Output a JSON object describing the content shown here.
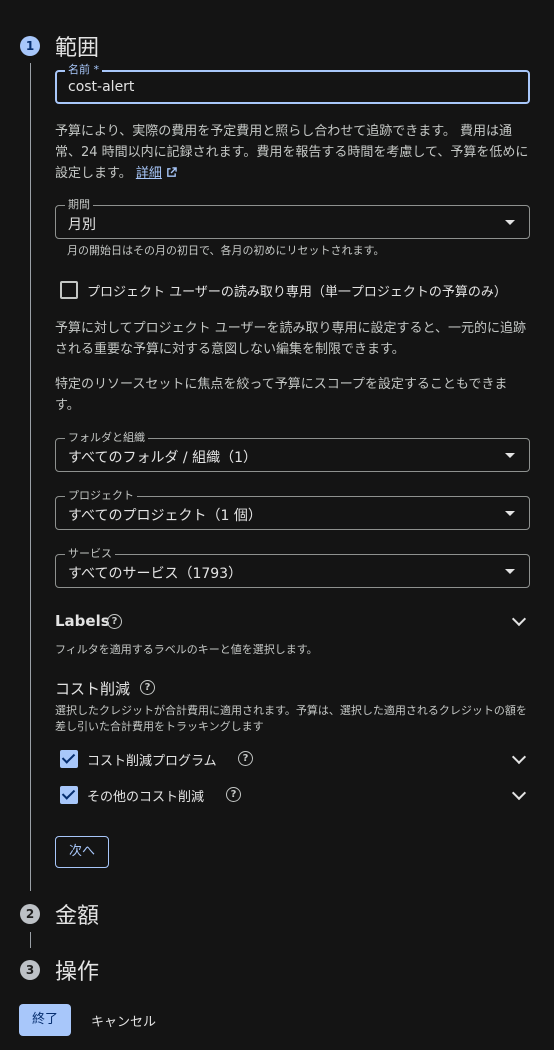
{
  "steps": [
    {
      "number": "1",
      "title": "範囲"
    },
    {
      "number": "2",
      "title": "金額"
    },
    {
      "number": "3",
      "title": "操作"
    }
  ],
  "name_field": {
    "label": "名前 *",
    "value": "cost-alert"
  },
  "intro_text": "予算により、実際の費用を予定費用と照らし合わせて追跡できます。 費用は通常、24 時間以内に記録されます。費用を報告する時間を考慮して、予算を低めに設定します。",
  "details_link": "詳細",
  "period": {
    "label": "期間",
    "value": "月別",
    "hint": "月の開始日はその月の初日で、各月の初めにリセットされます。"
  },
  "readonly_checkbox": {
    "label": "プロジェクト ユーザーの読み取り専用（単一プロジェクトの予算のみ）",
    "checked": false
  },
  "readonly_text": "予算に対してプロジェクト ユーザーを読み取り専用に設定すると、一元的に追跡される重要な予算に対する意図しない編集を制限できます。",
  "scope_text": "特定のリソースセットに焦点を絞って予算にスコープを設定することもできます。",
  "folders": {
    "label": "フォルダと組織",
    "value": "すべてのフォルダ / 組織（1）"
  },
  "projects": {
    "label": "プロジェクト",
    "value": "すべてのプロジェクト（1 個）"
  },
  "services": {
    "label": "サービス",
    "value": "すべてのサービス（1793）"
  },
  "labels": {
    "title": "Labels",
    "hint": "フィルタを適用するラベルのキーと値を選択します。"
  },
  "credits": {
    "title": "コスト削減",
    "hint": "選択したクレジットが合計費用に適用されます。予算は、選択した適用されるクレジットの額を差し引いた合計費用をトラッキングします",
    "items": [
      {
        "label": "コスト削減プログラム",
        "checked": true
      },
      {
        "label": "その他のコスト削減",
        "checked": true
      }
    ]
  },
  "next_button": "次へ",
  "finish_button": "終了",
  "cancel_button": "キャンセル",
  "colors": {
    "accent": "#a8c7fa",
    "background": "#141414",
    "text": "#e3e3e3"
  }
}
